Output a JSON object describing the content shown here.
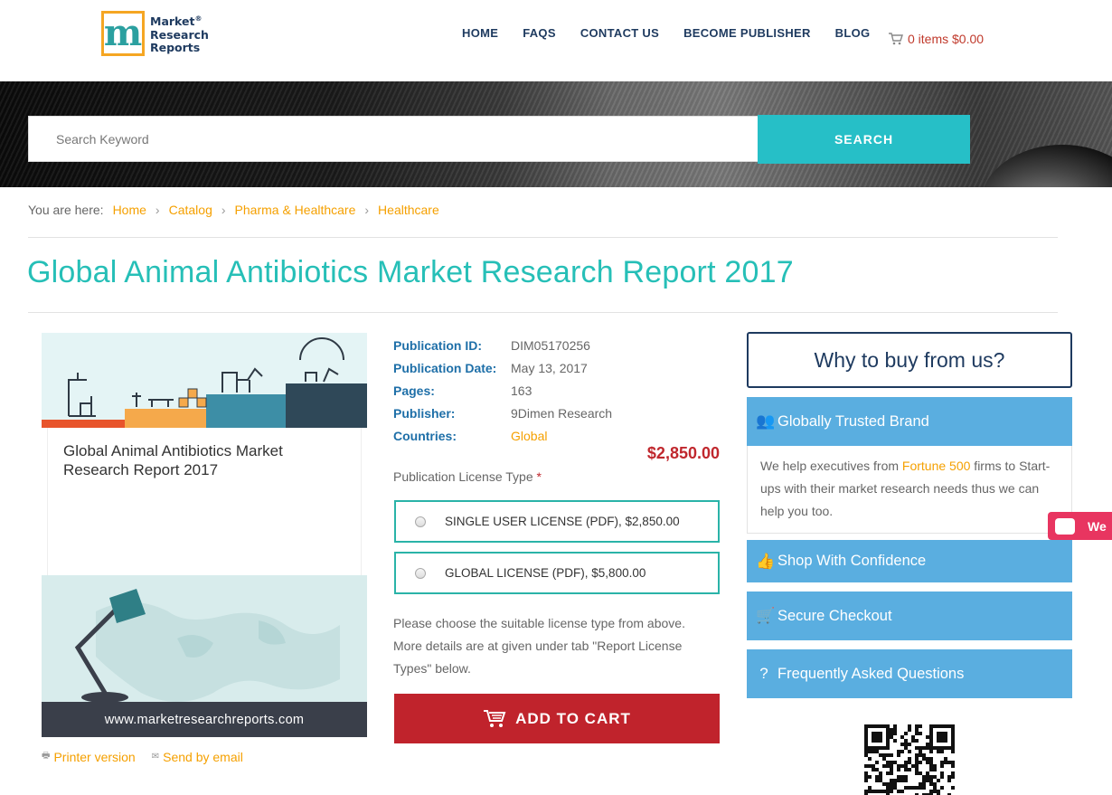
{
  "header": {
    "logo_text": [
      "Market",
      "Research",
      "Reports"
    ],
    "logo_registered": "®",
    "nav": [
      "HOME",
      "FAQS",
      "CONTACT US",
      "BECOME PUBLISHER",
      "BLOG"
    ],
    "cart_text": "0 items $0.00"
  },
  "search": {
    "placeholder": "Search Keyword",
    "button_label": "SEARCH"
  },
  "breadcrumb": {
    "prefix": "You are here:",
    "items": [
      "Home",
      "Catalog",
      "Pharma & Healthcare",
      "Healthcare"
    ]
  },
  "page_title": "Global Animal Antibiotics Market Research Report 2017",
  "cover": {
    "title": "Global Animal Antibiotics Market Research Report 2017",
    "url": "www.marketresearchreports.com",
    "printer_label": "Printer version",
    "email_label": "Send by email"
  },
  "details": {
    "rows": [
      {
        "label": "Publication ID:",
        "value": "DIM05170256"
      },
      {
        "label": "Publication Date:",
        "value": "May 13, 2017"
      },
      {
        "label": "Pages:",
        "value": "163"
      },
      {
        "label": "Publisher:",
        "value": "9Dimen Research"
      },
      {
        "label": "Countries:",
        "value": "Global"
      }
    ],
    "price": "$2,850.00",
    "license_type_label": "Publication License Type",
    "required_mark": "*",
    "licenses": [
      "SINGLE USER LICENSE (PDF), $2,850.00",
      "GLOBAL LICENSE (PDF), $5,800.00"
    ],
    "help_text": "Please choose the suitable license type from above. More details are at given under tab \"Report License Types\" below.",
    "add_to_cart": "ADD TO CART"
  },
  "sidebar": {
    "why_title": "Why to buy from us?",
    "trusted_title": "Globally Trusted Brand",
    "trusted_body_1": "We help executives from ",
    "trusted_highlight": "Fortune 500",
    "trusted_body_2": " firms to Start-ups with their market research needs thus we can help you too.",
    "shop_title": "Shop With Confidence",
    "secure_title": "Secure Checkout",
    "faq_title": "Frequently Asked Questions",
    "chat_label": "We"
  },
  "colors": {
    "accent_teal": "#26bfb7",
    "nav_navy": "#1e3a5f",
    "link_orange": "#f5a000",
    "price_red": "#c0272d",
    "panel_blue": "#5aaee0",
    "chat_pink": "#e83560"
  }
}
